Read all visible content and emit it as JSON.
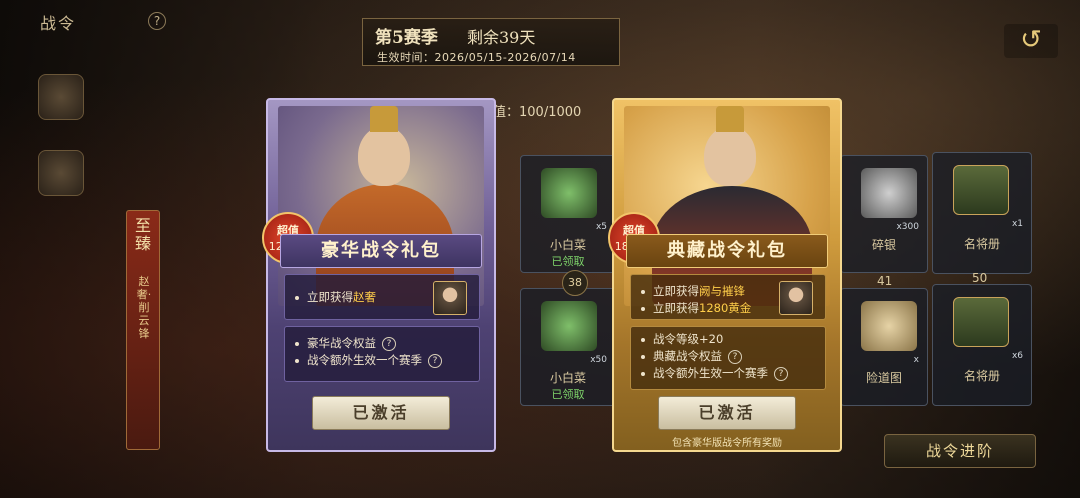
{
  "header": {
    "title": "战令",
    "help": "?",
    "back_icon": "return-arrow-icon"
  },
  "season": {
    "title": "第5赛季",
    "remaining": "剩余39天",
    "time": "生效时间：2026/05/15-2026/07/14"
  },
  "progress": {
    "text": "值：100/1000"
  },
  "side": {
    "rank_title": "至臻",
    "rank_sub": "赵奢·削云锋"
  },
  "rewards": [
    {
      "name": "小白菜",
      "status": "已领取",
      "count": "x5"
    },
    {
      "name": "小白菜",
      "status": "已领取",
      "count": "x50"
    },
    {
      "name": "碎银",
      "status": "",
      "count": "x300"
    },
    {
      "name": "名将册",
      "status": "",
      "count": "x1"
    },
    {
      "name": "险道图",
      "status": "",
      "count": "x"
    },
    {
      "name": "名将册",
      "status": "",
      "count": "x6"
    }
  ],
  "levels": [
    "38",
    "41",
    "50"
  ],
  "packs": {
    "luxury": {
      "title": "豪华战令礼包",
      "tag_a": "超值",
      "tag_b": "1200%",
      "instant_prefix": "立即获得",
      "instant_highlight": "赵奢",
      "perks": [
        "豪华战令权益",
        "战令额外生效一个赛季"
      ],
      "button": "已激活"
    },
    "collector": {
      "title": "典藏战令礼包",
      "tag_a": "超值",
      "tag_b": "1800%",
      "instant_prefix_1": "立即获得",
      "instant_highlight_1": "阙与摧锋",
      "instant_prefix_2": "立即获得",
      "instant_highlight_2": "1280黄金",
      "perks": [
        "战令等级+20",
        "典藏战令权益",
        "战令额外生效一个赛季"
      ],
      "button": "已激活",
      "note": "包含豪华版战令所有奖励"
    }
  },
  "advance_button": "战令进阶",
  "colors": {
    "luxury_purple": "#6e5e95",
    "collector_gold": "#cf9b3d",
    "highlight": "#ffce4a",
    "claimed_green": "#7ed36a"
  }
}
